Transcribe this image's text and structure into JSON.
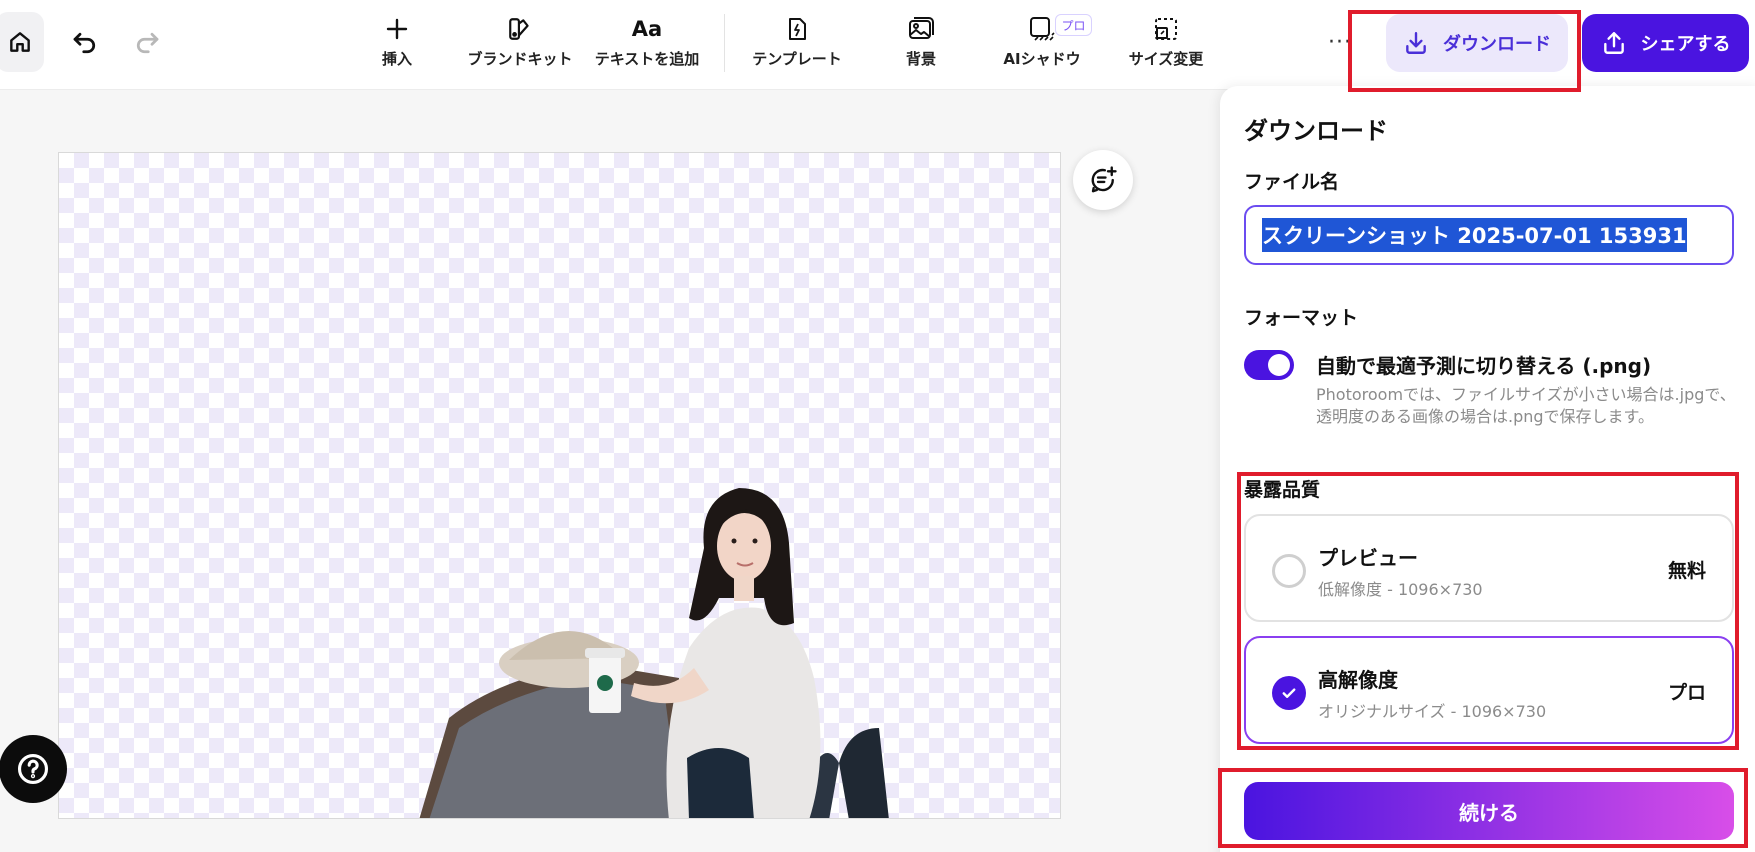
{
  "toolbar": {
    "tools": [
      {
        "label": "挿入",
        "icon": "plus-icon"
      },
      {
        "label": "ブランドキット",
        "icon": "brand-kit-icon"
      },
      {
        "label": "テキストを追加",
        "icon": "text-aa-icon"
      },
      {
        "label": "テンプレート",
        "icon": "template-icon"
      },
      {
        "label": "背景",
        "icon": "background-image-icon"
      },
      {
        "label": "AIシャドウ",
        "icon": "ai-shadow-icon"
      },
      {
        "label": "サイズ変更",
        "icon": "resize-icon"
      }
    ],
    "ai_shadow_badge": "プロ",
    "more": "···",
    "download_label": "ダウンロード",
    "share_label": "シェアする"
  },
  "panel": {
    "title": "ダウンロード",
    "filename_label": "ファイル名",
    "filename_value": "スクリーンショット 2025-07-01 153931",
    "format_label": "フォーマット",
    "auto_toggle_label": "自動で最適予測に切り替える (.png)",
    "auto_toggle_on": true,
    "auto_toggle_desc": "Photoroomでは、ファイルサイズが小さい場合は.jpgで、透明度のある画像の場合は.pngで保存します。",
    "quality_label": "暴露品質",
    "options": [
      {
        "name": "プレビュー",
        "sub": "低解像度 - 1096×730",
        "price": "無料",
        "selected": false
      },
      {
        "name": "高解像度",
        "sub": "オリジナルサイズ - 1096×730",
        "price": "プロ",
        "selected": true
      }
    ],
    "continue_label": "続ける"
  },
  "colors": {
    "accent": "#4a14e0",
    "accent_light": "#ece8fb",
    "highlight_box": "#e01c2c",
    "gradient_end": "#d84ee8"
  }
}
